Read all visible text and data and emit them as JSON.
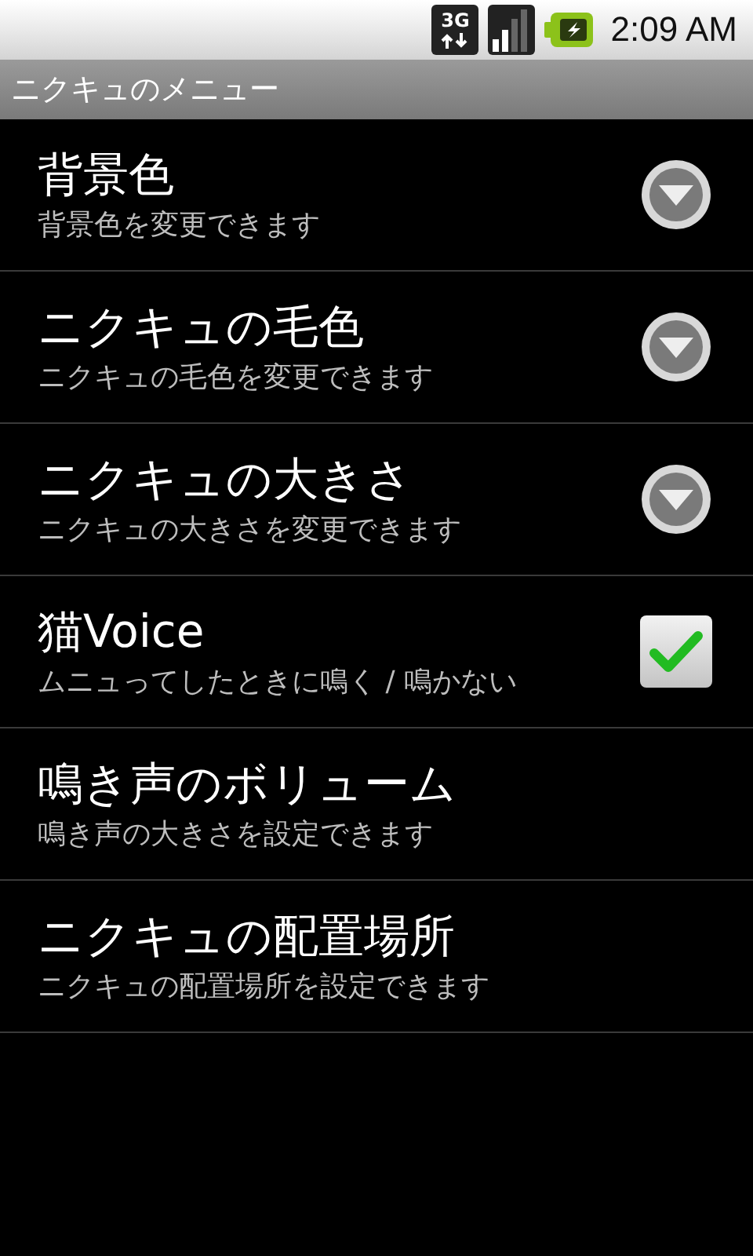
{
  "status_bar": {
    "network": "3G",
    "time": "2:09 AM"
  },
  "window": {
    "title": "ニクキュのメニュー"
  },
  "preferences": [
    {
      "kind": "list",
      "title": "背景色",
      "summary": "背景色を変更できます"
    },
    {
      "kind": "list",
      "title": "ニクキュの毛色",
      "summary": "ニクキュの毛色を変更できます"
    },
    {
      "kind": "list",
      "title": "ニクキュの大きさ",
      "summary": "ニクキュの大きさを変更できます"
    },
    {
      "kind": "checkbox",
      "title": "猫Voice",
      "summary": "ムニュってしたときに鳴く / 鳴かない",
      "checked": true
    },
    {
      "kind": "plain",
      "title": "鳴き声のボリューム",
      "summary": "鳴き声の大きさを設定できます"
    },
    {
      "kind": "plain",
      "title": "ニクキュの配置場所",
      "summary": "ニクキュの配置場所を設定できます"
    }
  ]
}
